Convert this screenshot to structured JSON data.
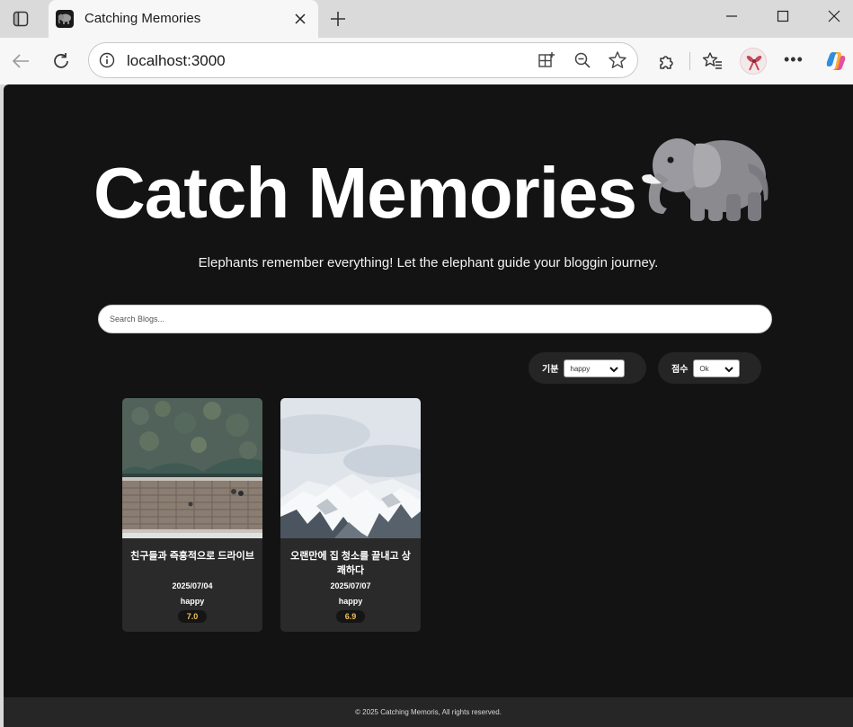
{
  "browser": {
    "tab_title": "Catching Memories",
    "url": "localhost:3000"
  },
  "hero": {
    "title": "Catch Memories",
    "tagline": "Elephants remember everything! Let the elephant guide your bloggin journey."
  },
  "search": {
    "placeholder": "Search Blogs..."
  },
  "filters": [
    {
      "label": "기분",
      "value": "happy"
    },
    {
      "label": "점수",
      "value": "Ok"
    }
  ],
  "posts": [
    {
      "title": "친구들과 즉흥적으로 드라이브",
      "date": "2025/07/04",
      "mood": "happy",
      "score": "7.0"
    },
    {
      "title": "오랜만에 집 청소를 끝내고 상쾌하다",
      "date": "2025/07/07",
      "mood": "happy",
      "score": "6.9"
    }
  ],
  "footer": {
    "text": "© 2025 Catching Memoris, All rights reserved."
  },
  "colors": {
    "page_bg": "#131313",
    "card_bg": "#2a2a2a",
    "score_text": "#f0c060"
  }
}
